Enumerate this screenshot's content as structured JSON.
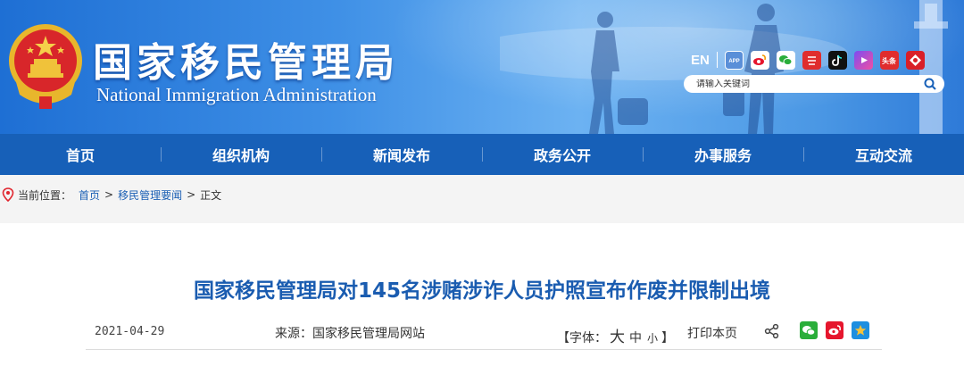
{
  "header": {
    "title_cn": "国家移民管理局",
    "title_en": "National Immigration Administration",
    "en_link": "EN",
    "social_icons": [
      "app-icon",
      "weibo-icon",
      "wechat-icon",
      "toutiao-icon",
      "douyin-icon",
      "kuaishou-icon",
      "toutiaohao-icon",
      "mix-icon"
    ],
    "search_placeholder": "请输入关键词"
  },
  "nav": {
    "items": [
      "首页",
      "组织机构",
      "新闻发布",
      "政务公开",
      "办事服务",
      "互动交流"
    ]
  },
  "breadcrumb": {
    "label": "当前位置：",
    "home": "首页",
    "section": "移民管理要闻",
    "current": "正文",
    "sep": ">"
  },
  "article": {
    "title": "国家移民管理局对145名涉赌涉诈人员护照宣布作废并限制出境",
    "date": "2021-04-29",
    "source": "来源：国家移民管理局网站",
    "font_open": "【字体：",
    "font_large": "大",
    "font_medium": "中",
    "font_small": "小",
    "font_close": "】",
    "print": "打印本页"
  },
  "colors": {
    "nav_bg": "#1760b8",
    "title_blue": "#1a5cb0",
    "link_blue": "#1a5fb4"
  }
}
